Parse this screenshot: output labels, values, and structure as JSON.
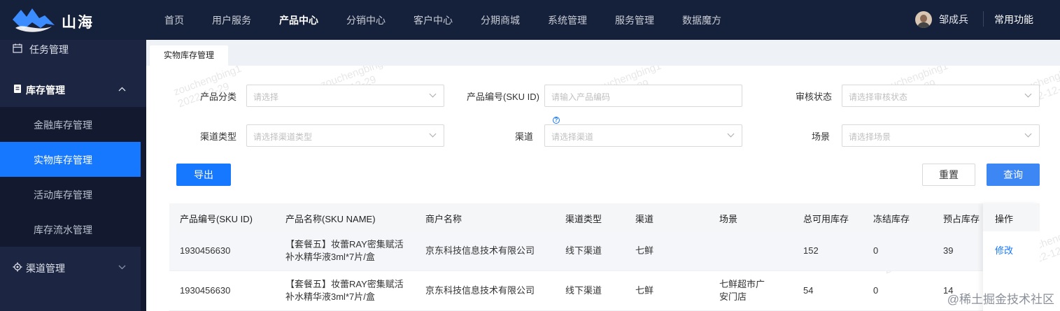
{
  "app": {
    "brand": "山海"
  },
  "topnav": [
    "首页",
    "用户服务",
    "产品中心",
    "分销中心",
    "客户中心",
    "分期商城",
    "系统管理",
    "服务管理",
    "数据魔方"
  ],
  "user": {
    "name": "邹成兵",
    "common_functions": "常用功能"
  },
  "sidebar": {
    "task": "任务管理",
    "inventory": "库存管理",
    "sub": [
      "金融库存管理",
      "实物库存管理",
      "活动库存管理",
      "库存流水管理"
    ],
    "channel": "渠道管理"
  },
  "tab": "实物库存管理",
  "filters": {
    "category_label": "产品分类",
    "category_ph": "请选择",
    "sku_label": "产品编号(SKU ID)",
    "sku_ph": "请输入产品编码",
    "audit_label": "审核状态",
    "audit_ph": "请选择审核状态",
    "channel_type_label": "渠道类型",
    "channel_type_ph": "请选择渠道类型",
    "channel_label": "渠道",
    "channel_ph": "请选择渠道",
    "scene_label": "场景",
    "scene_ph": "请选择场景"
  },
  "buttons": {
    "export": "导出",
    "reset": "重置",
    "query": "查询"
  },
  "table": {
    "headers": [
      "产品编号(SKU ID)",
      "产品名称(SKU NAME)",
      "商户名称",
      "渠道类型",
      "渠道",
      "场景",
      "总可用库存",
      "冻结库存",
      "预占库存",
      "操作"
    ],
    "rows": [
      {
        "sku": "1930456630",
        "name": "【套餐五】妆蕾RAY密集赋活补水精华液3ml*7片/盒",
        "merchant": "京东科技信息技术有限公司",
        "channel_type": "线下渠道",
        "channel": "七鲜",
        "scene": "",
        "available": "152",
        "frozen": "0",
        "reserved": "39",
        "op": "修改"
      },
      {
        "sku": "1930456630",
        "name": "【套餐五】妆蕾RAY密集赋活补水精华液3ml*7片/盒",
        "merchant": "京东科技信息技术有限公司",
        "channel_type": "线下渠道",
        "channel": "七鲜",
        "scene": "七鲜超市广安门店",
        "available": "54",
        "frozen": "0",
        "reserved": "14",
        "op": ""
      }
    ]
  },
  "watermark": {
    "name": "zouchengbing1",
    "date": "2022-12-29"
  },
  "footer": "@稀土掘金技术社区",
  "colors": {
    "topbar": "#15203a",
    "sidebar": "#1c2541",
    "primary": "#1677ff"
  }
}
